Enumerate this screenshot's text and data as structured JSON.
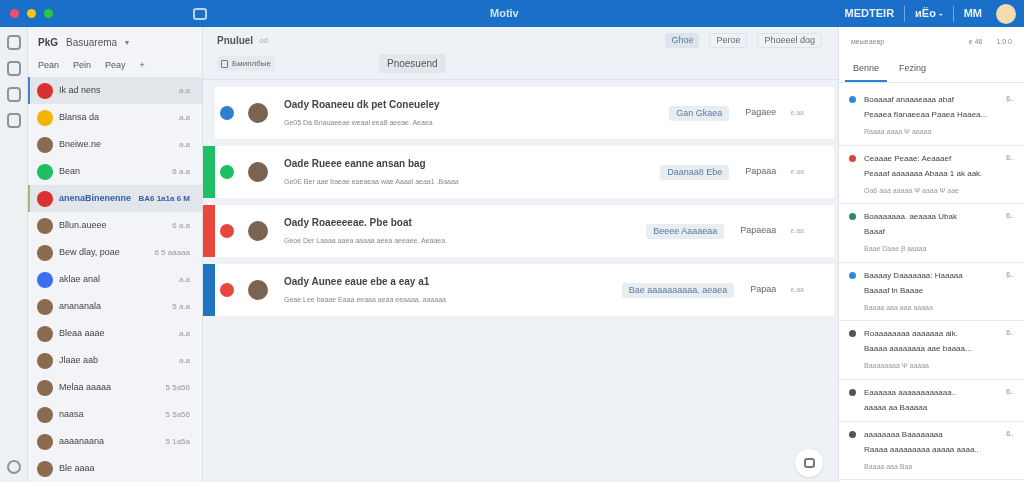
{
  "window": {
    "title": "Motiv"
  },
  "topbar": {
    "items": [
      "MEDTEIR",
      "иЁо -",
      "MM"
    ]
  },
  "sidebar": {
    "workspace": "PkG",
    "title": "Basuarema",
    "caret": "▾",
    "tabs": [
      "Pean",
      "Pein",
      "Peay",
      "+"
    ],
    "items": [
      {
        "kind": "icon",
        "color": "#dc2f2f",
        "name": "Ik ad nens",
        "time": "a.a",
        "selected": true
      },
      {
        "kind": "icon",
        "color": "#f4b400",
        "name": "Blansa da",
        "time": "a.a",
        "selected": false
      },
      {
        "kind": "photo",
        "name": "Bneiwe.ne",
        "time": "a.a",
        "selected": false
      },
      {
        "kind": "icon",
        "color": "#1fbf63",
        "name": "Bean",
        "time": "6 a.a",
        "selected": false
      },
      {
        "kind": "icon",
        "color": "#dc2f2f",
        "name": "anenaBinenenne",
        "time": "BA6 1a1a 6 M",
        "selected": true
      },
      {
        "kind": "photo",
        "name": "Bllun.aueee",
        "time": "6 a.a",
        "selected": false
      },
      {
        "kind": "photo",
        "name": "Bew dlay, poae",
        "time": "6 5 aaaaa",
        "selected": false
      },
      {
        "kind": "icon",
        "color": "#3b6ff0",
        "name": "aklae anal",
        "time": "a.a",
        "selected": false
      },
      {
        "kind": "photo",
        "name": "anananala",
        "time": "5 a.a",
        "selected": false
      },
      {
        "kind": "photo",
        "name": "Bleaa aaae",
        "time": "a.a",
        "selected": false
      },
      {
        "kind": "photo",
        "name": "Jlaae aab",
        "time": "a.a",
        "selected": false
      },
      {
        "kind": "photo",
        "name": "Melaa aaaaa",
        "time": "5 5a56",
        "selected": false
      },
      {
        "kind": "photo",
        "name": "naasa",
        "time": "5 5a56",
        "selected": false
      },
      {
        "kind": "photo",
        "name": "aaaanaana",
        "time": "5 1a5a",
        "selected": false
      },
      {
        "kind": "photo",
        "name": "Ble aaaa",
        "selected": false
      }
    ]
  },
  "main": {
    "title": "Pnuluel",
    "title_hint": "od",
    "actions": [
      {
        "label": "Ghoe",
        "selected": true
      },
      {
        "label": "Peroe",
        "selected": false
      },
      {
        "label": "Phoeeel dog",
        "selected": false
      }
    ],
    "filter": "Бмиплбые",
    "button": "Pnoesuend",
    "cards": [
      {
        "color": "#2f7fd0",
        "title": "Oady  Roaneeu dk pet Coneueley",
        "subtitle": "Ge05 Da Bnauaeeae weaal eea8 aeeae. Aeaea",
        "tag": "Gan Gkaea",
        "status": "Pagaee",
        "time": "e.aa"
      },
      {
        "accent": {
          "color": "#1fbf63"
        },
        "color": "#1fbf63",
        "title": "Oade  Rueee eanne ansan bag",
        "subtitle": "Ge0E Ber aae baeae eaeaeaa wae Aaaal aeaa1 .Baaaa",
        "tag": "Daanaa8 Ebe",
        "status": "Papaaa",
        "time": "e.aa"
      },
      {
        "accent": {
          "color": "#e8473e"
        },
        "color": "#e8473e",
        "title": "Oady  Roaeeeeae. Pbe boat",
        "subtitle": "Geoe Der Laaaa aaea aaaaa aeea aeeaee. Aeaaea",
        "tag": "Beeee Aaaaeaa",
        "status": "Papaeaa",
        "time": "e.aa"
      },
      {
        "accent": {
          "color": "#1f75c0"
        },
        "color": "#e8473e",
        "title": "Oady  Aunee eaue ebe a eay a1",
        "subtitle": "Geae Lee baaae Eaaa eeaaa aeaa eeaaaa. aaaaaa",
        "tag": "Bae aaaaaaaaaa. aeaea",
        "status": "Papaa",
        "time": "e.aa"
      }
    ]
  },
  "panel": {
    "title": "меыеаевр",
    "stats": [
      "e 46",
      "1:0 0"
    ],
    "tabs": [
      {
        "label": "Benne",
        "selected": true
      },
      {
        "label": "Fezing",
        "selected": false
      }
    ],
    "items": [
      {
        "color": "#2b8bd6",
        "title": "Boaaaaf anaaaeaaa abaf",
        "line2": "Peaaea fIanaeeaa Paaea Haaea...",
        "meta": "Raaaa aaaa  Ψ aaaaa",
        "time": "6.."
      },
      {
        "color": "#d9463b",
        "title": "Ceaaae Peaae: Aeaaaef",
        "line2": "Peaaaf aaaaaaa Abaaa 1 ak aak.",
        "meta": "Oa6 aaa aaaaa  Ψ aaaa  Ψ aae",
        "time": "6.."
      },
      {
        "color": "#2e8b57",
        "title": "Boaaaaaaa. aeaaaa Ubak",
        "line2": "Baaaf",
        "meta": "Baae Daae  Ꞵ aaaaa",
        "time": "6.."
      },
      {
        "color": "#2b8bd6",
        "title": "Baaaay Daaaaaaa: Haaaaa",
        "line2": "Baaaaf ln Baaae",
        "meta": "Baaaa aaa aaa aaaaa",
        "time": "6.."
      },
      {
        "color": "#555555",
        "title": "Roaaaaaaaa aaaaaaa aik.",
        "line2": "Baaaa aaaaaaaa aae baaaa...",
        "meta": "Baaaaaaaa  Ψ aaaaa",
        "time": "6.."
      },
      {
        "color": "#555555",
        "title": "Eaaaaaa aaaaaaaaaaaa..",
        "line2": "aaaaa aa Baaaaa",
        "time": "6.."
      },
      {
        "color": "#555555",
        "title": "aaaaaaaa Baaaaaaaa",
        "line2": "Raaaa aaaaaaaaa aaaaa aaaa..",
        "meta": "Baaaa  aaa  Baa",
        "time": "6.."
      }
    ]
  }
}
